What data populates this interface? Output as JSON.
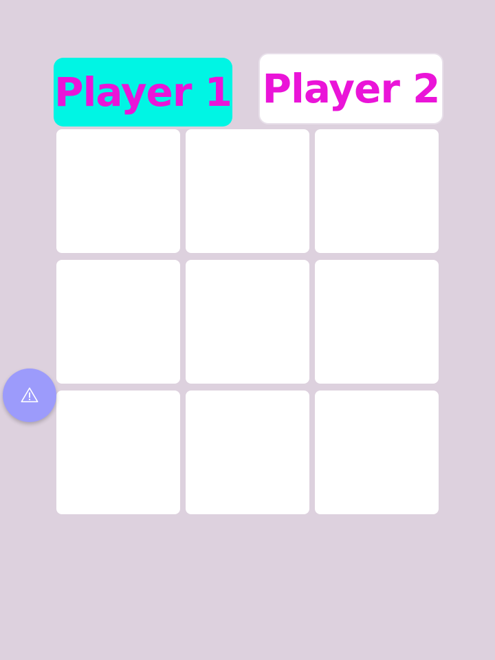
{
  "players": [
    {
      "label": "Player 1",
      "active": true,
      "color": "#00f5e4",
      "text_color": "#ea14d8"
    },
    {
      "label": "Player 2",
      "active": false,
      "color": "#ffffff",
      "text_color": "#ea14d8"
    }
  ],
  "board": {
    "rows": 3,
    "cols": 3,
    "cells": [
      "",
      "",
      "",
      "",
      "",
      "",
      "",
      "",
      ""
    ]
  },
  "fab": {
    "icon": "warning-icon",
    "color": "#9c9bfb"
  },
  "colors": {
    "background": "#ddd1de",
    "cell": "#ffffff"
  }
}
